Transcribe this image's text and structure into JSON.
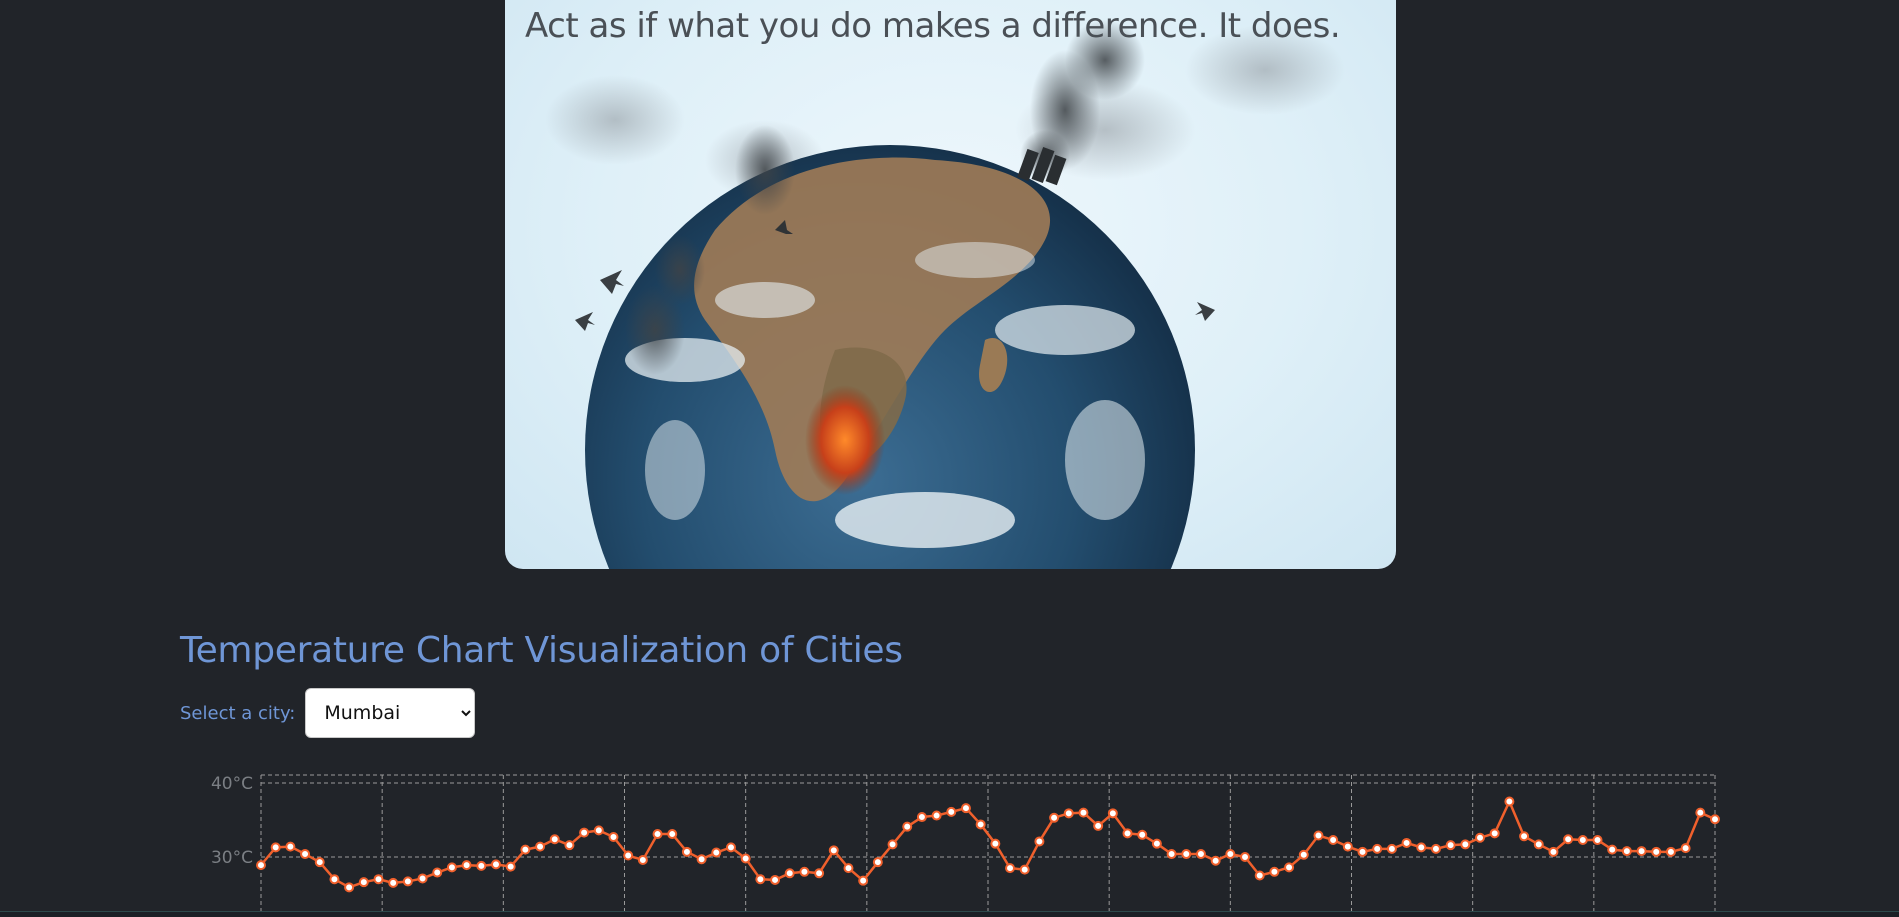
{
  "hero": {
    "quote": "Act as if what you do makes a difference. It does."
  },
  "chart_section": {
    "title": "Temperature Chart Visualization of Cities",
    "city_label": "Select a city:",
    "city_selected": "Mumbai"
  },
  "chart_data": {
    "type": "line",
    "title": "",
    "xlabel": "",
    "ylabel": "",
    "ylim": [
      20,
      40
    ],
    "y_tick_labels": [
      "40°C",
      "30°C"
    ],
    "y_ticks": [
      40,
      30
    ],
    "grid": true,
    "line_color": "#f0602c",
    "series": [
      {
        "values": [
          28.9,
          31.3,
          31.4,
          30.4,
          29.3,
          27.0,
          25.9,
          26.6,
          27.0,
          26.5,
          26.7,
          27.1,
          27.9,
          28.6,
          28.9,
          28.8,
          29.0,
          28.7,
          31.0,
          31.4,
          32.4,
          31.6,
          33.3,
          33.6,
          32.7,
          30.2,
          29.6,
          33.1,
          33.1,
          30.7,
          29.7,
          30.6,
          31.3,
          29.8,
          27.0,
          26.9,
          27.8,
          28.0,
          27.8,
          30.9,
          28.5,
          26.8,
          29.3,
          31.7,
          34.1,
          35.4,
          35.6,
          36.1,
          36.6,
          34.4,
          31.8,
          28.5,
          28.3,
          32.1,
          35.3,
          35.9,
          36.0,
          34.2,
          35.9,
          33.2,
          33.0,
          31.8,
          30.4,
          30.4,
          30.4,
          29.5,
          30.4,
          30.0,
          27.5,
          28.0,
          28.6,
          30.3,
          32.9,
          32.3,
          31.4,
          30.7,
          31.1,
          31.1,
          31.9,
          31.3,
          31.1,
          31.6,
          31.7,
          32.6,
          33.2,
          37.5,
          32.8,
          31.7,
          30.7,
          32.4,
          32.3,
          32.3,
          31.0,
          30.8,
          30.8,
          30.7,
          30.7,
          31.2,
          36.0,
          35.1
        ]
      }
    ]
  }
}
